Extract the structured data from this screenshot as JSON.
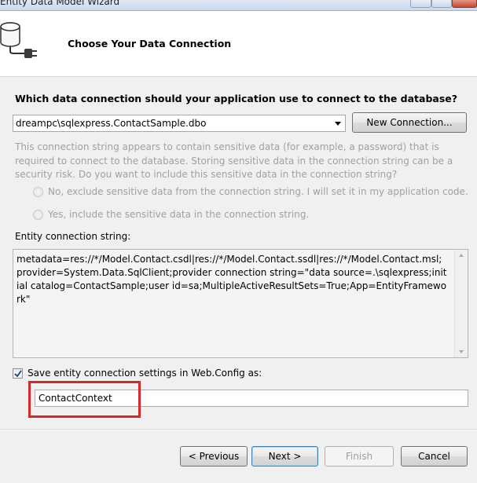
{
  "window": {
    "title": "Entity Data Model Wizard"
  },
  "header": {
    "heading": "Choose Your Data Connection",
    "icon": "database-plug-icon"
  },
  "connection": {
    "question": "Which data connection should your application use to connect to the database?",
    "selected": "dreampc\\sqlexpress.ContactSample.dbo",
    "new_connection_label": "New Connection..."
  },
  "sensitive": {
    "description": "This connection string appears to contain sensitive data (for example, a password) that is required to connect to the database. Storing sensitive data in the connection string can be a security risk. Do you want to include this sensitive data in the connection string?",
    "option_no": "No, exclude sensitive data from the connection string. I will set it in my application code.",
    "option_yes": "Yes, include the sensitive data in the connection string."
  },
  "entity_connection": {
    "label": "Entity connection string:",
    "value": "metadata=res://*/Model.Contact.csdl|res://*/Model.Contact.ssdl|res://*/Model.Contact.msl;provider=System.Data.SqlClient;provider connection string=\"data source=.\\sqlexpress;initial catalog=ContactSample;user id=sa;MultipleActiveResultSets=True;App=EntityFramework\""
  },
  "save": {
    "checked": true,
    "label": "Save entity connection settings in Web.Config as:",
    "value": "ContactContext"
  },
  "footer": {
    "previous_label": "< Previous",
    "next_label": "Next >",
    "finish_label": "Finish",
    "cancel_label": "Cancel"
  },
  "colors": {
    "highlight": "#d42a2a",
    "disabled_text": "#a0a0a0"
  }
}
